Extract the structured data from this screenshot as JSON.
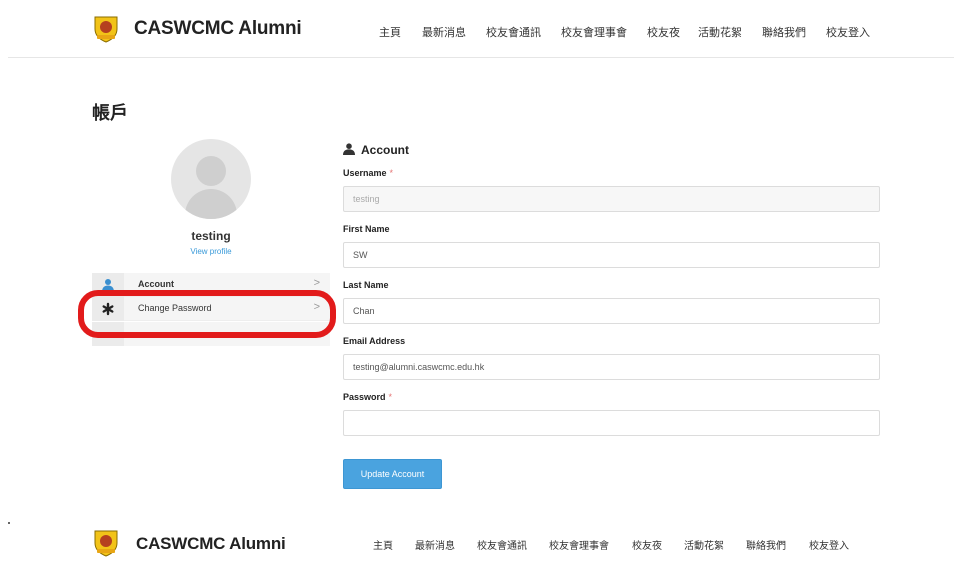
{
  "header": {
    "brand": "CASWCMC Alumni",
    "nav": [
      "主頁",
      "最新消息",
      "校友會通訊",
      "校友會理事會",
      "校友夜",
      "活動花絮",
      "聯絡我們",
      "校友登入"
    ]
  },
  "page": {
    "title": "帳戶"
  },
  "profile": {
    "name": "testing",
    "view_profile": "View profile"
  },
  "side_menu": {
    "items": [
      {
        "label": "Account",
        "icon": "user-icon",
        "arrow": ">"
      },
      {
        "label": "Change Password",
        "icon": "asterisk-icon",
        "arrow": ">"
      }
    ]
  },
  "form": {
    "heading": "Account",
    "heading_icon": "user-icon",
    "username_label": "Username",
    "username_value": "testing",
    "first_name_label": "First Name",
    "first_name_value": "SW",
    "last_name_label": "Last Name",
    "last_name_value": "Chan",
    "email_label": "Email Address",
    "email_value": "testing@alumni.caswcmc.edu.hk",
    "password_label": "Password",
    "password_value": "",
    "required_mark": "*",
    "submit_label": "Update Account"
  },
  "footer": {
    "brand": "CASWCMC Alumni",
    "nav": [
      "主頁",
      "最新消息",
      "校友會通訊",
      "校友會理事會",
      "校友夜",
      "活動花絮",
      "聯絡我們",
      "校友登入"
    ]
  },
  "colors": {
    "accent": "#4aa3df",
    "highlight": "#e21b1b",
    "link": "#3a9ad9"
  }
}
